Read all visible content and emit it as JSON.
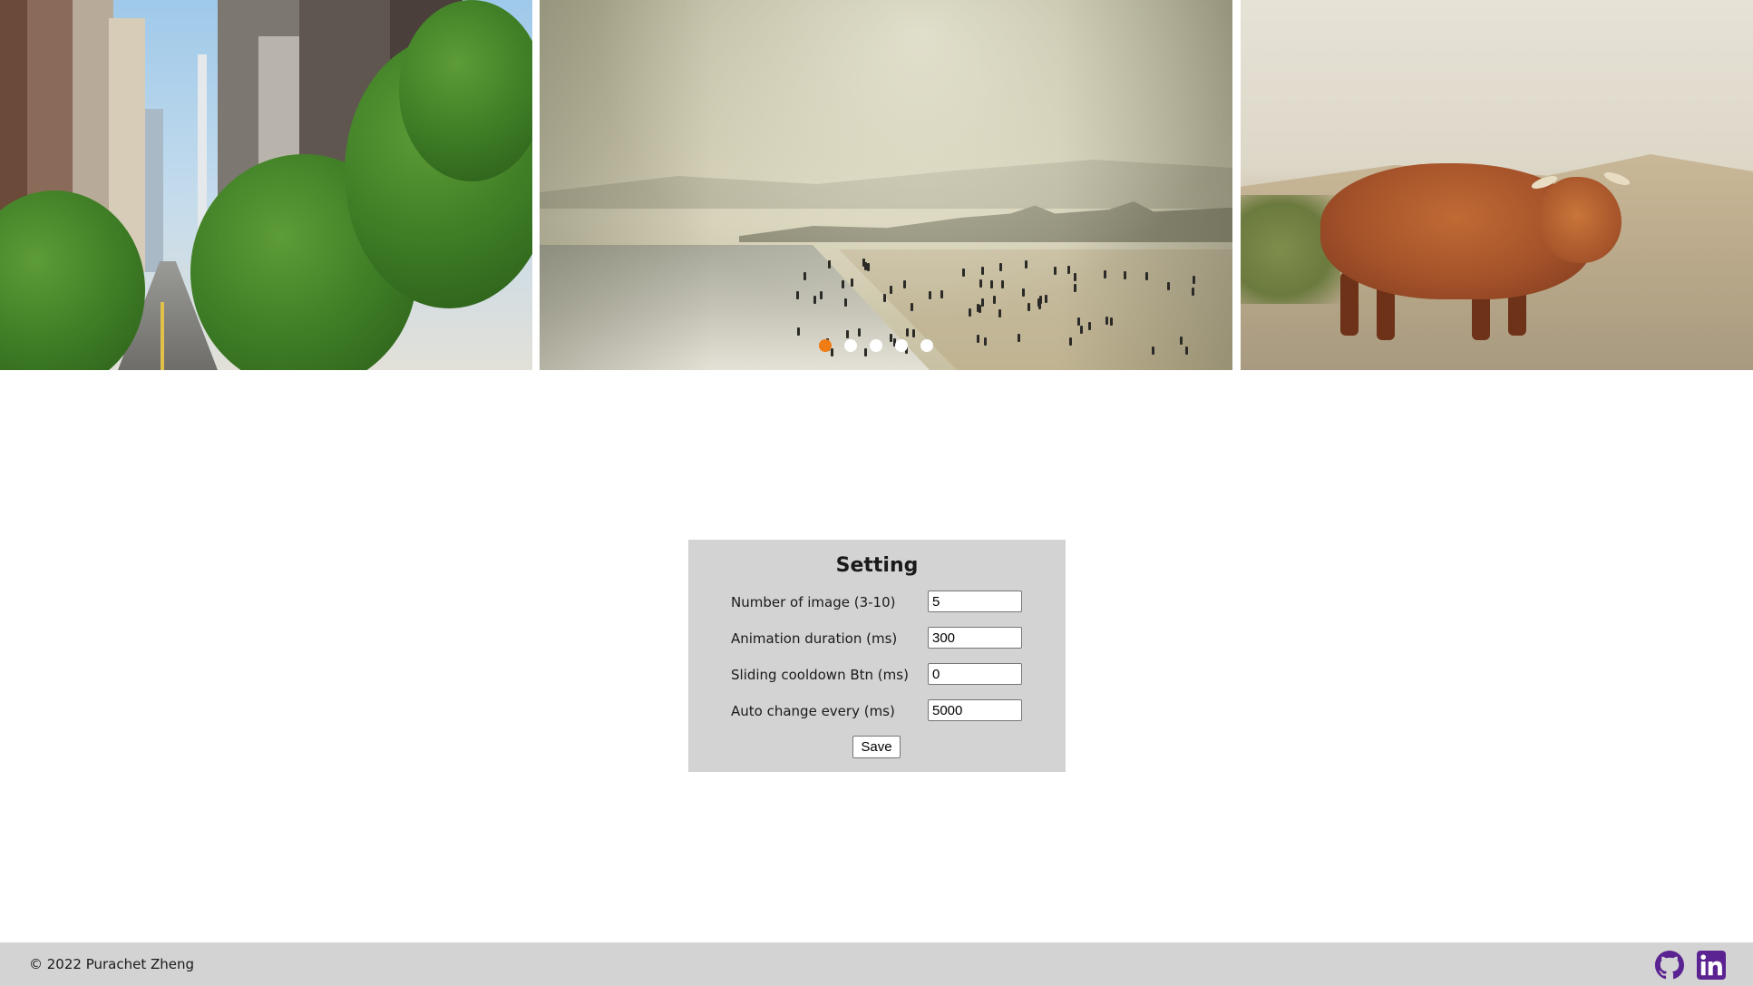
{
  "carousel": {
    "slides": [
      {
        "name": "city-street-photo"
      },
      {
        "name": "beach-photo"
      },
      {
        "name": "highland-cow-photo"
      }
    ],
    "dot_count": 5,
    "active_dot": 1,
    "colors": {
      "active_dot": "#f07c14",
      "inactive_dot": "#ffffff"
    }
  },
  "settings": {
    "title": "Setting",
    "fields": [
      {
        "label": "Number of image (3-10)",
        "value": "5"
      },
      {
        "label": "Animation duration (ms)",
        "value": "300"
      },
      {
        "label": "Sliding cooldown Btn (ms)",
        "value": "0"
      },
      {
        "label": "Auto change every (ms)",
        "value": "5000"
      }
    ],
    "save_label": "Save",
    "background": "#d3d3d3"
  },
  "footer": {
    "copyright": "© 2022 Purachet Zheng",
    "icons": [
      "github-icon",
      "linkedin-icon"
    ],
    "icon_color": "#5b2391",
    "background": "#d3d3d3"
  }
}
